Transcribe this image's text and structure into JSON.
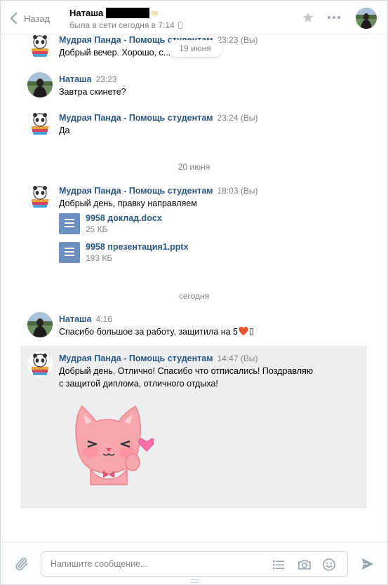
{
  "header": {
    "back_label": "Назад",
    "peer_name": "Наташа",
    "peer_badge": "∞",
    "status": "была в сети сегодня в 7:14"
  },
  "floating_date": "19 июня",
  "messages": [
    {
      "author": "Мудрая Панда - Помощь студентам",
      "time": "23:23 (Вы)",
      "text": "Добрый вечер. Хорошо, с..."
    },
    {
      "author": "Наташа",
      "time": "23:23",
      "text": "Завтра скинете?"
    },
    {
      "author": "Мудрая Панда - Помощь студентам",
      "time": "23:24 (Вы)",
      "text": "Да"
    },
    {
      "author": "Мудрая Панда - Помощь студентам",
      "time": "18:03 (Вы)",
      "text": "Добрый день, правку направляем"
    },
    {
      "author": "Наташа",
      "time": "4:16",
      "text": "Спасибо большое за работу, защитила на 5"
    },
    {
      "author": "Мудрая Панда - Помощь студентам",
      "time": "14:47 (Вы)",
      "text_line1": "Добрый день. Отлично! Спасибо что отписались! Поздравляю",
      "text_line2": "с защитой диплома, отличного отдыха!"
    }
  ],
  "date_separators": [
    "20 июня",
    "сегодня"
  ],
  "attachments": [
    {
      "name": "9958 доклад.docx",
      "size": "25 КБ"
    },
    {
      "name": "9958 презентация1.pptx",
      "size": "193 КБ"
    }
  ],
  "composer": {
    "placeholder": "Напишите сообщение..."
  },
  "icons": {
    "back": "chevron-left-icon",
    "star": "star-icon",
    "more": "more-icon",
    "attach": "paperclip-icon",
    "templates": "list-icon",
    "camera": "camera-icon",
    "emoji": "smile-icon",
    "send": "send-icon"
  },
  "colors": {
    "link": "#2a5885",
    "muted": "#828282",
    "doc": "#6d8fc0",
    "selected_bg": "#edeef0",
    "heart": "#e8532a"
  }
}
